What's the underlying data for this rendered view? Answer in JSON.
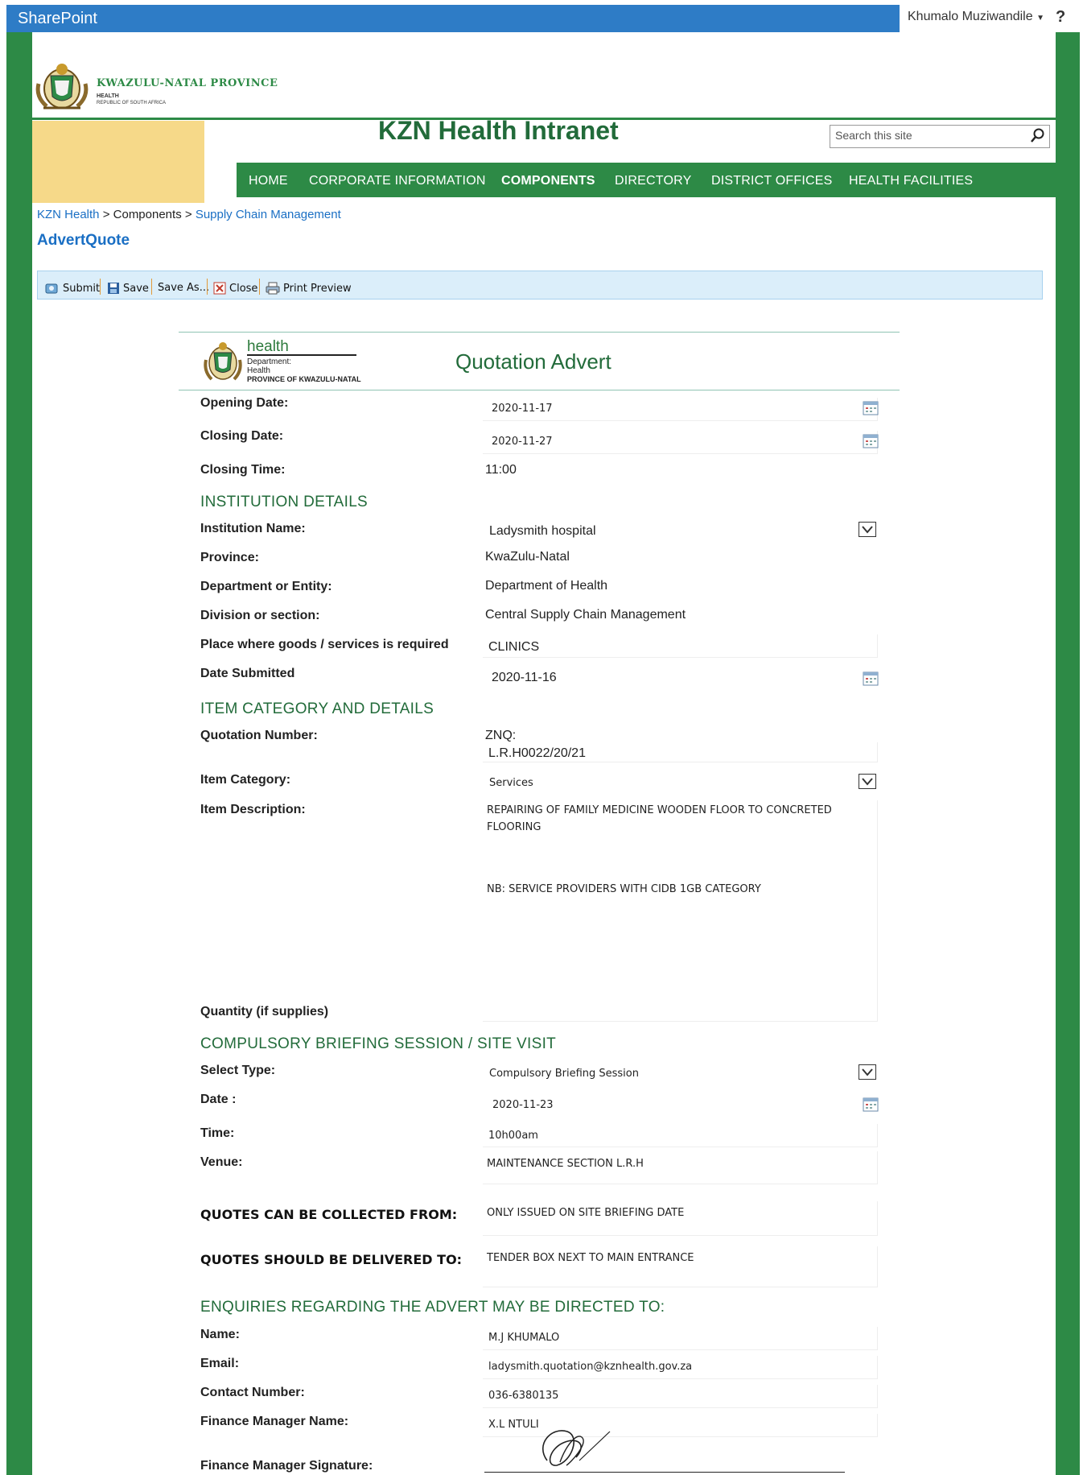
{
  "topbar": {
    "title": "SharePoint",
    "user": "Khumalo Muziwandile",
    "help": "?"
  },
  "branding": {
    "province": "KWAZULU-NATAL PROVINCE",
    "sub1": "HEALTH",
    "sub2": "REPUBLIC OF SOUTH AFRICA",
    "site_title": "KZN Health Intranet"
  },
  "search": {
    "placeholder": "Search this site"
  },
  "nav": {
    "items": [
      "HOME",
      "CORPORATE INFORMATION",
      "COMPONENTS",
      "DIRECTORY",
      "DISTRICT OFFICES",
      "HEALTH FACILITIES"
    ],
    "active": "COMPONENTS"
  },
  "breadcrumb": {
    "root": "KZN Health",
    "sep": ">",
    "middle": "Components",
    "current": "Supply Chain Management"
  },
  "page_title": "AdvertQuote",
  "toolbar": {
    "submit": "Submit",
    "save": "Save",
    "save_as": "Save As...",
    "close": "Close",
    "print_preview": "Print Preview"
  },
  "form": {
    "header": {
      "health": "health",
      "dept1": "Department:",
      "dept2": "Health",
      "dept3": "PROVINCE OF KWAZULU-NATAL",
      "title": "Quotation Advert"
    },
    "opening_date": {
      "label": "Opening Date:",
      "value": "2020-11-17"
    },
    "closing_date": {
      "label": "Closing Date:",
      "value": "2020-11-27"
    },
    "closing_time": {
      "label": "Closing Time:",
      "value": "11:00"
    },
    "institution_heading": "INSTITUTION DETAILS",
    "institution_name": {
      "label": "Institution Name:",
      "value": "Ladysmith hospital"
    },
    "province": {
      "label": "Province:",
      "value": "KwaZulu-Natal"
    },
    "department": {
      "label": "Department or Entity:",
      "value": "Department of Health"
    },
    "division": {
      "label": "Division or section:",
      "value": "Central Supply Chain Management"
    },
    "place": {
      "label": "Place where goods /  services is required",
      "value": "CLINICS"
    },
    "date_submitted": {
      "label": "Date Submitted",
      "value": "2020-11-16"
    },
    "item_heading": "ITEM CATEGORY AND DETAILS",
    "quotation_number": {
      "label": "Quotation Number:",
      "prefix": "ZNQ:",
      "value": "L.R.H0022/20/21"
    },
    "item_category": {
      "label": "Item Category:",
      "value": "Services"
    },
    "item_description": {
      "label": "Item Description:",
      "line1": "REPAIRING OF FAMILY MEDICINE WOODEN FLOOR TO CONCRETED",
      "line2": "FLOORING",
      "note": "NB: SERVICE PROVIDERS WITH CIDB 1GB CATEGORY"
    },
    "quantity": {
      "label": "Quantity (if supplies)",
      "value": ""
    },
    "briefing_heading": "COMPULSORY BRIEFING SESSION / SITE VISIT",
    "select_type": {
      "label": "Select Type:",
      "value": "Compulsory Briefing Session"
    },
    "briefing_date": {
      "label": "Date :",
      "value": "2020-11-23"
    },
    "briefing_time": {
      "label": "Time:",
      "value": "10h00am"
    },
    "venue": {
      "label": "Venue:",
      "value": "MAINTENANCE SECTION L.R.H"
    },
    "collect_from": {
      "label": "QUOTES CAN BE COLLECTED FROM:",
      "value": "ONLY ISSUED ON SITE BRIEFING DATE"
    },
    "deliver_to": {
      "label": "QUOTES SHOULD BE DELIVERED TO:",
      "value": "TENDER BOX NEXT TO MAIN ENTRANCE"
    },
    "enquiries_heading": "ENQUIRIES REGARDING THE ADVERT MAY BE DIRECTED TO:",
    "name": {
      "label": "Name:",
      "value": "M.J KHUMALO"
    },
    "email": {
      "label": "Email:",
      "value": "ladysmith.quotation@kznhealth.gov.za"
    },
    "contact": {
      "label": "Contact Number:",
      "value": "036-6380135"
    },
    "finance_name": {
      "label": "Finance Manager Name:",
      "value": "X.L NTULI"
    },
    "finance_signature": {
      "label": "Finance Manager Signature:"
    }
  },
  "colors": {
    "brand_green": "#2d8a46",
    "sharepoint_blue": "#2e7cc6",
    "link_blue": "#1a6fc4",
    "section_green": "#226b3a"
  }
}
